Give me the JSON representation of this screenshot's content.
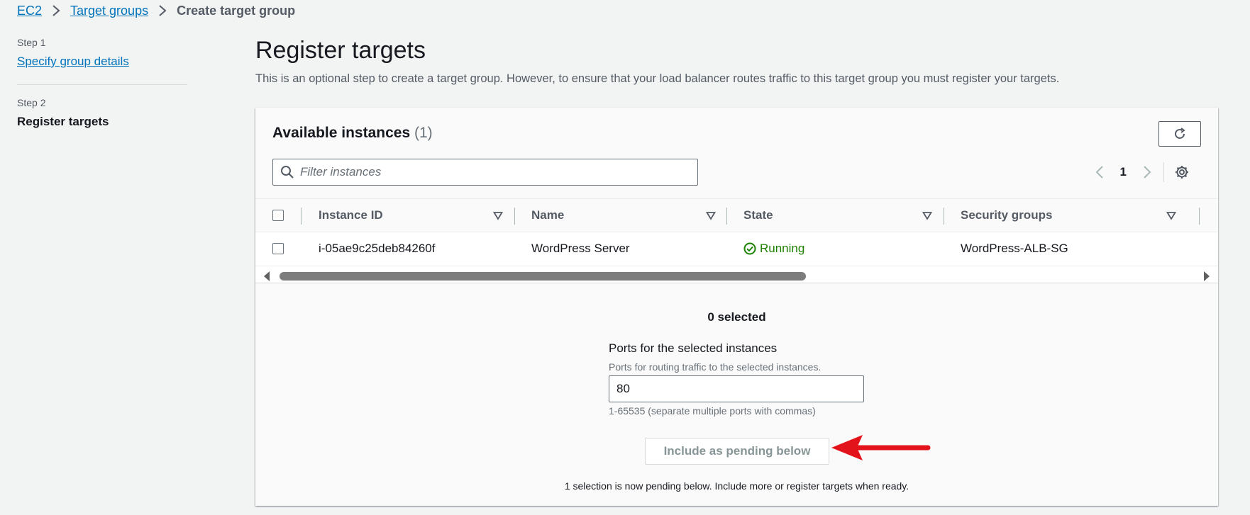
{
  "breadcrumb": {
    "items": [
      "EC2",
      "Target groups"
    ],
    "current": "Create target group"
  },
  "steps": {
    "step1": {
      "label": "Step 1",
      "title": "Specify group details"
    },
    "step2": {
      "label": "Step 2",
      "title": "Register targets"
    }
  },
  "page": {
    "title": "Register targets",
    "description": "This is an optional step to create a target group. However, to ensure that your load balancer routes traffic to this target group you must register your targets."
  },
  "instances": {
    "title": "Available instances",
    "count": "(1)",
    "filter_placeholder": "Filter instances",
    "page": "1",
    "columns": [
      "Instance ID",
      "Name",
      "State",
      "Security groups"
    ],
    "rows": [
      {
        "instance_id": "i-05ae9c25deb84260f",
        "name": "WordPress Server",
        "state": "Running",
        "security_groups": "WordPress-ALB-SG"
      }
    ]
  },
  "selection": {
    "count_label": "0 selected",
    "ports_label": "Ports for the selected instances",
    "ports_desc": "Ports for routing traffic to the selected instances.",
    "ports_value": "80",
    "ports_hint": "1-65535 (separate multiple ports with commas)",
    "pending_button": "Include as pending below",
    "pending_note": "1 selection is now pending below. Include more or register targets when ready."
  },
  "colors": {
    "link": "#0073bb",
    "running": "#1d8102",
    "annotation_arrow": "#e3131b"
  },
  "icons": [
    "chevron-right-icon",
    "refresh-icon",
    "search-icon",
    "chevron-left-icon",
    "gear-icon",
    "sort-triangle-icon",
    "status-ok-icon",
    "red-arrow-annotation"
  ]
}
